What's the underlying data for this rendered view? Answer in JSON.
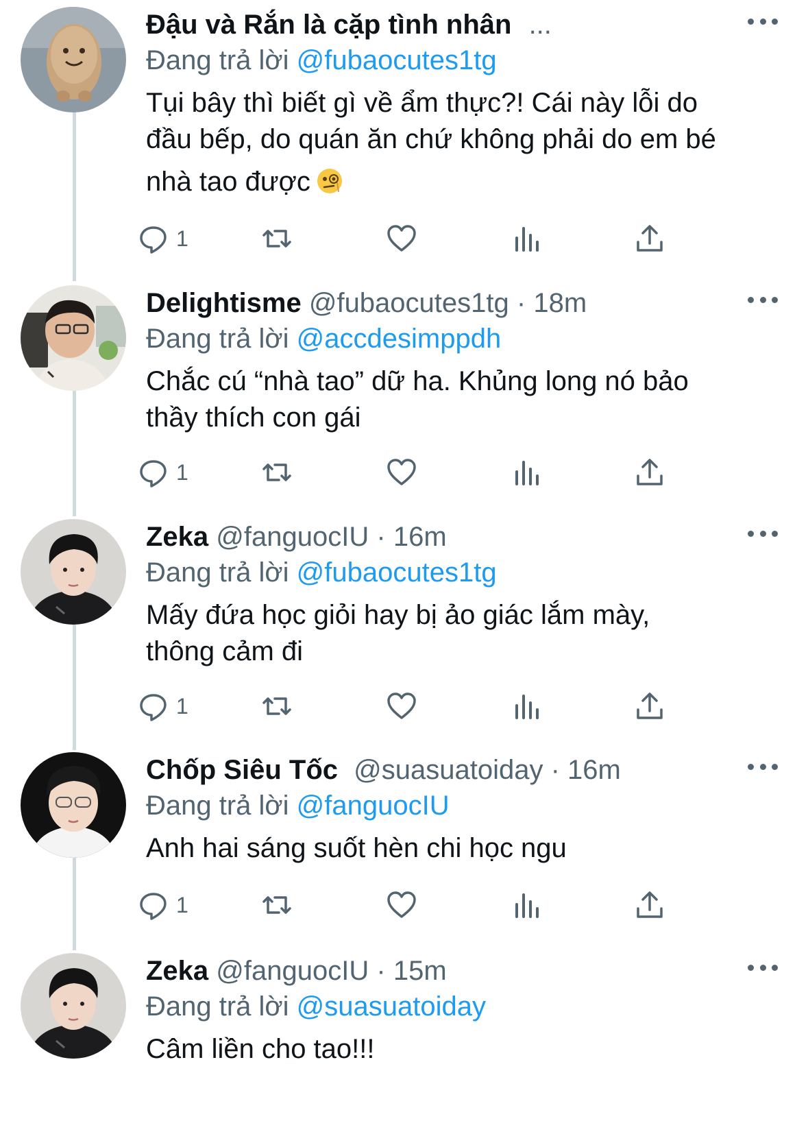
{
  "tweets": [
    {
      "name": "Đậu và Rắn là cặp tình nhân",
      "handle": "",
      "time": "",
      "truncated": "...",
      "reply_prefix": "Đang trả lời",
      "reply_to": "@fubaocutes1tg",
      "lines": [
        "Tụi bây thì biết gì về ẩm thực?! Cái này lỗi do",
        "đầu bếp, do quán ăn chứ không phải do em bé",
        "nhà tao được"
      ],
      "emoji": "face-with-monocle-icon",
      "reply_count": "1"
    },
    {
      "name": "Delightisme",
      "handle": "@fubaocutes1tg",
      "sep": "·",
      "time": "18m",
      "reply_prefix": "Đang trả lời",
      "reply_to": "@accdesimppdh",
      "lines": [
        "Chắc cú “nhà tao” dữ ha. Khủng long nó bảo",
        "thầy thích con gái"
      ],
      "reply_count": "1"
    },
    {
      "name": "Zeka",
      "handle": "@fanguocIU",
      "sep": "·",
      "time": "16m",
      "reply_prefix": "Đang trả lời",
      "reply_to": "@fubaocutes1tg",
      "lines": [
        "Mấy đứa học giỏi hay bị ảo giác lắm mày,",
        "thông cảm đi"
      ],
      "reply_count": "1"
    },
    {
      "name": "Chốp Siêu Tốc",
      "handle": "@suasuatoiday",
      "sep": "·",
      "time": "16m",
      "reply_prefix": "Đang trả lời",
      "reply_to": "@fanguocIU",
      "lines": [
        "Anh hai sáng suốt hèn chi học ngu"
      ],
      "reply_count": "1"
    },
    {
      "name": "Zeka",
      "handle": "@fanguocIU",
      "sep": "·",
      "time": "15m",
      "reply_prefix": "Đang trả lời",
      "reply_to": "@suasuatoiday",
      "lines": [
        "Câm liền cho tao!!!"
      ]
    }
  ],
  "colors": {
    "text": "#0f1419",
    "secondary": "#536471",
    "link": "#1d9bf0",
    "thread_line": "#cfd9de"
  },
  "icons": [
    "reply-icon",
    "retweet-icon",
    "like-icon",
    "views-icon",
    "share-icon",
    "more-icon"
  ]
}
